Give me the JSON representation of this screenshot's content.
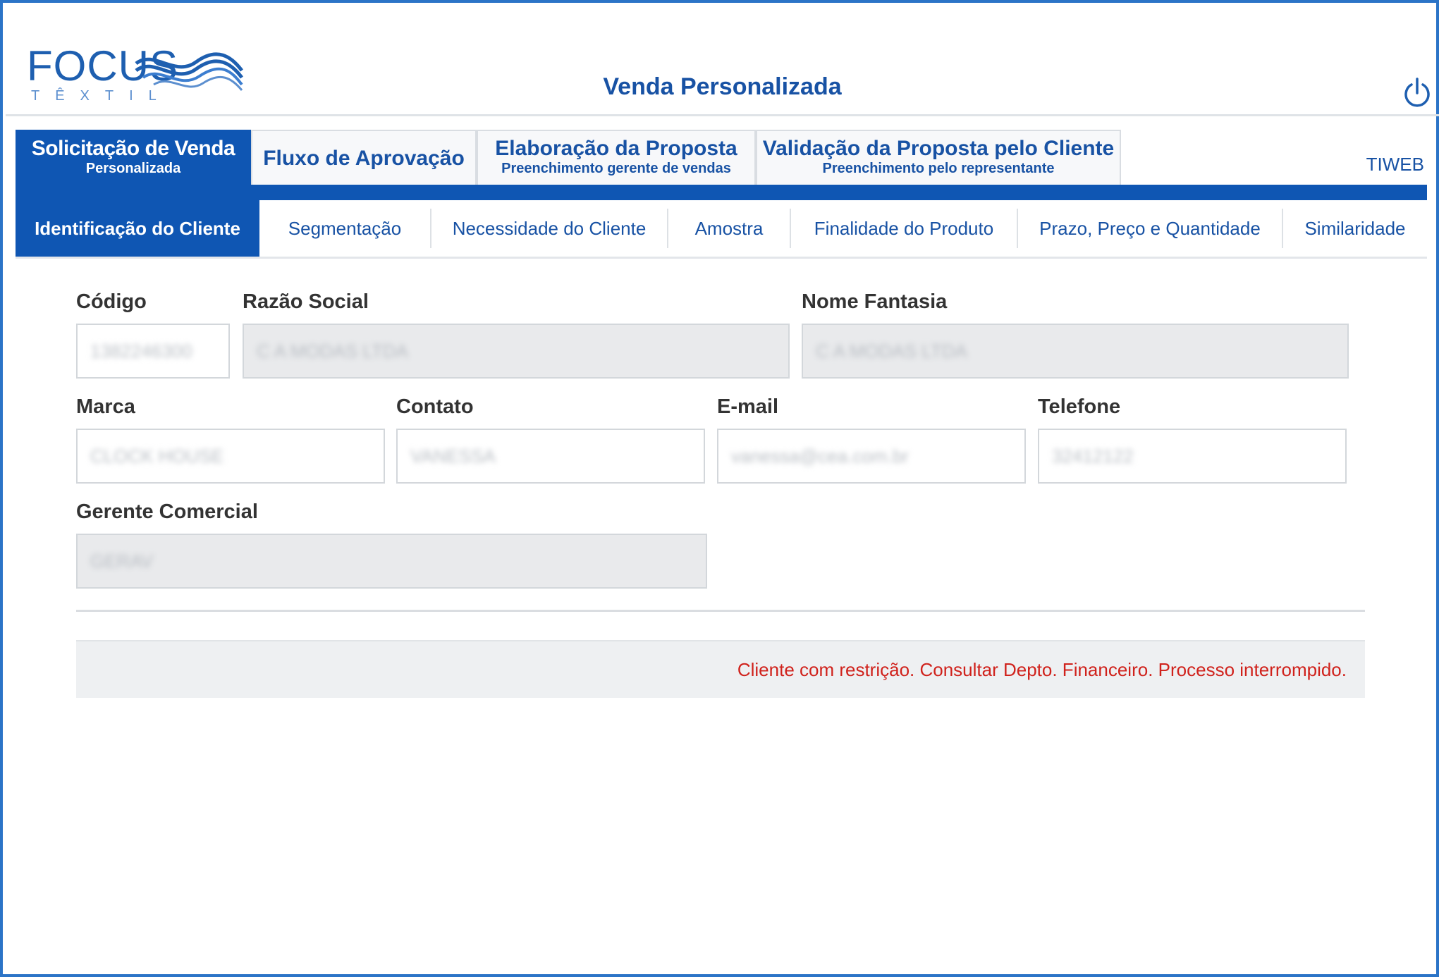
{
  "header": {
    "logo_text": "FOCUS",
    "logo_sub": "TÊXTIL",
    "title": "Venda Personalizada",
    "power_icon": "power-icon"
  },
  "stage_tabs": [
    {
      "title": "Solicitação de Venda",
      "subtitle": "Personalizada",
      "active": true
    },
    {
      "title": "Fluxo de Aprovação",
      "subtitle": "",
      "active": false
    },
    {
      "title": "Elaboração da Proposta",
      "subtitle": "Preenchimento gerente de vendas",
      "active": false
    },
    {
      "title": "Validação da Proposta pelo Cliente",
      "subtitle": "Preenchimento pelo representante",
      "active": false
    }
  ],
  "system_label": "TIWEB",
  "sub_tabs": [
    {
      "label": "Identificação do Cliente",
      "active": true
    },
    {
      "label": "Segmentação",
      "active": false
    },
    {
      "label": "Necessidade do Cliente",
      "active": false
    },
    {
      "label": "Amostra",
      "active": false
    },
    {
      "label": "Finalidade do Produto",
      "active": false
    },
    {
      "label": "Prazo, Preço e Quantidade",
      "active": false
    },
    {
      "label": "Similaridade",
      "active": false
    }
  ],
  "form": {
    "codigo": {
      "label": "Código",
      "value": "1382246300"
    },
    "razao_social": {
      "label": "Razão Social",
      "value": "C A MODAS LTDA"
    },
    "nome_fantasia": {
      "label": "Nome Fantasia",
      "value": "C A MODAS LTDA"
    },
    "marca": {
      "label": "Marca",
      "value": "CLOCK HOUSE"
    },
    "contato": {
      "label": "Contato",
      "value": "VANESSA"
    },
    "email": {
      "label": "E-mail",
      "value": "vanessa@cea.com.br"
    },
    "telefone": {
      "label": "Telefone",
      "value": "32412122"
    },
    "gerente": {
      "label": "Gerente Comercial",
      "value": "GERAV"
    }
  },
  "message": "Cliente com restrição. Consultar Depto. Financeiro. Processo interrompido.",
  "colors": {
    "primary": "#0f56b3",
    "frame": "#2b74c7",
    "error": "#d0221c"
  }
}
